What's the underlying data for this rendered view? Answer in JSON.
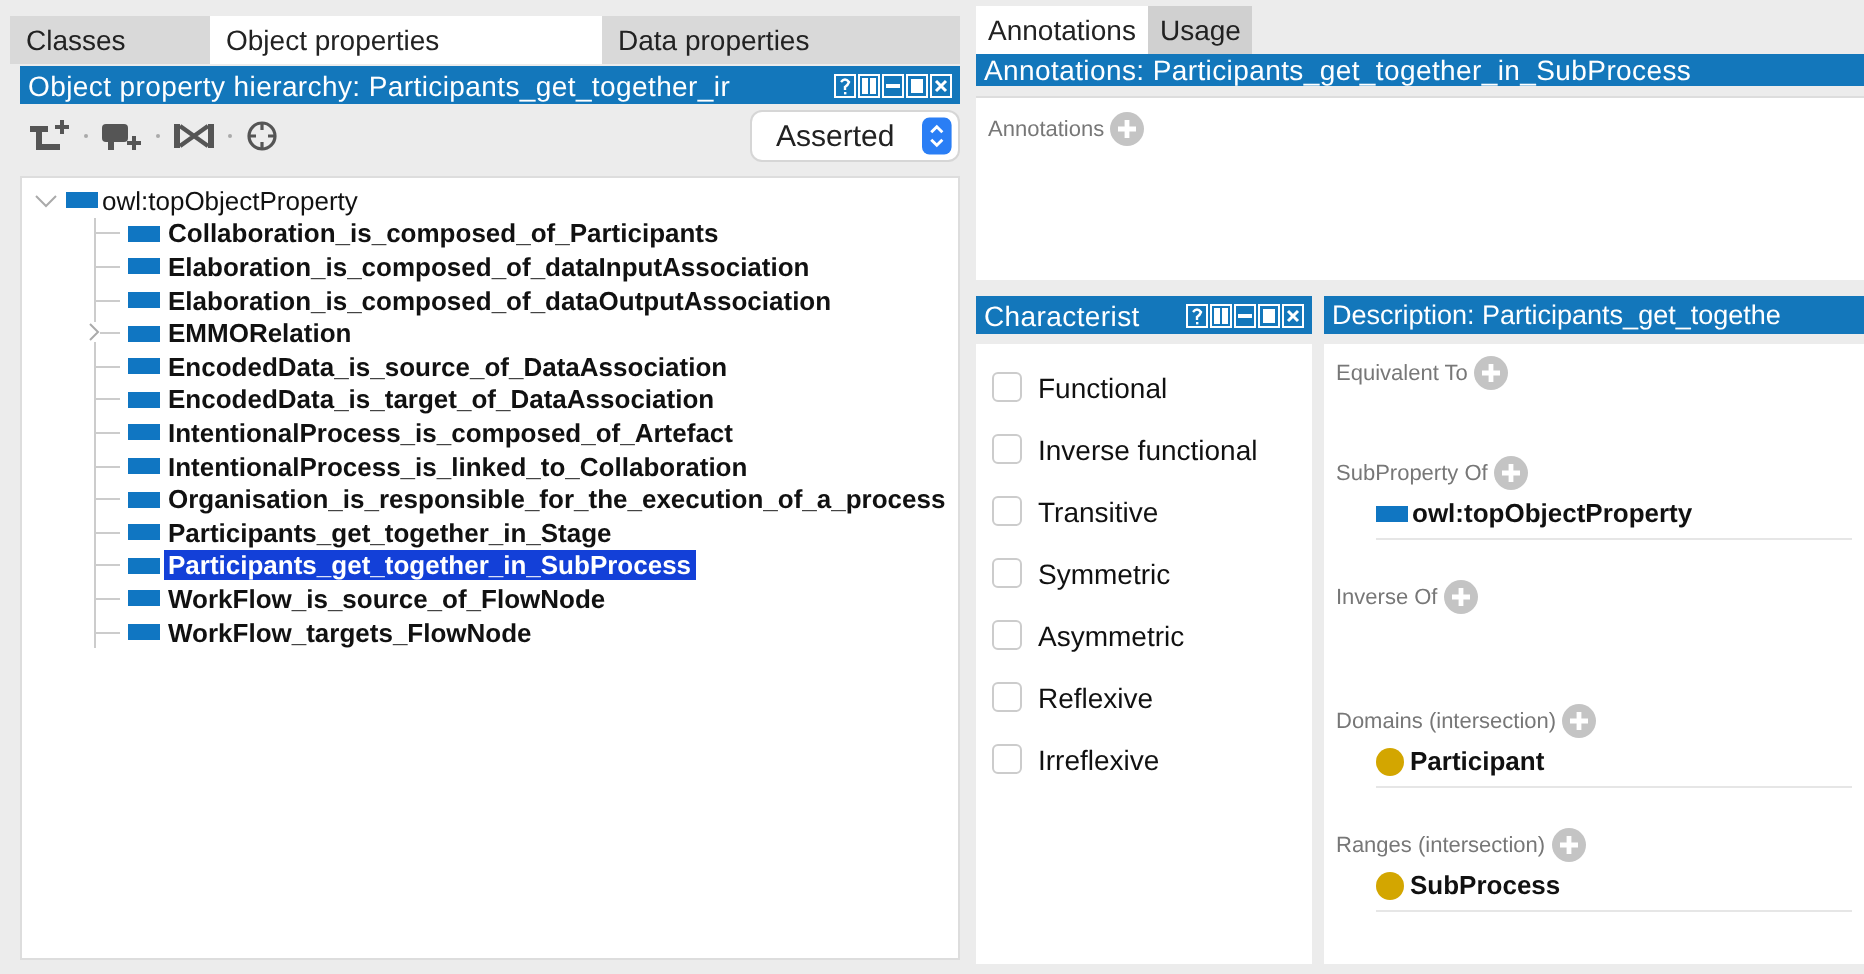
{
  "left_tabs": [
    {
      "label": "Classes",
      "selected": false
    },
    {
      "label": "Object properties",
      "selected": true
    },
    {
      "label": "Data properties",
      "selected": false
    }
  ],
  "hierarchy_panel": {
    "title": "Object property hierarchy: Participants_get_together_ir",
    "mode": "Asserted",
    "root": {
      "label": "owl:topObjectProperty",
      "expanded": true,
      "children": [
        {
          "label": "Collaboration_is_composed_of_Participants",
          "selected": false,
          "expandable": false
        },
        {
          "label": "Elaboration_is_composed_of_dataInputAssociation",
          "selected": false,
          "expandable": false
        },
        {
          "label": "Elaboration_is_composed_of_dataOutputAssociation",
          "selected": false,
          "expandable": false
        },
        {
          "label": "EMMORelation",
          "selected": false,
          "expandable": true
        },
        {
          "label": "EncodedData_is_source_of_DataAssociation",
          "selected": false,
          "expandable": false
        },
        {
          "label": "EncodedData_is_target_of_DataAssociation",
          "selected": false,
          "expandable": false
        },
        {
          "label": "IntentionalProcess_is_composed_of_Artefact",
          "selected": false,
          "expandable": false
        },
        {
          "label": "IntentionalProcess_is_linked_to_Collaboration",
          "selected": false,
          "expandable": false
        },
        {
          "label": "Organisation_is_responsible_for_the_execution_of_a_process",
          "selected": false,
          "expandable": false
        },
        {
          "label": "Participants_get_together_in_Stage",
          "selected": false,
          "expandable": false
        },
        {
          "label": "Participants_get_together_in_SubProcess",
          "selected": true,
          "expandable": false
        },
        {
          "label": "WorkFlow_is_source_of_FlowNode",
          "selected": false,
          "expandable": false
        },
        {
          "label": "WorkFlow_targets_FlowNode",
          "selected": false,
          "expandable": false
        }
      ]
    }
  },
  "right_tabs": [
    {
      "label": "Annotations",
      "selected": true
    },
    {
      "label": "Usage",
      "selected": false
    }
  ],
  "annotations_panel": {
    "title": "Annotations: Participants_get_together_in_SubProcess",
    "section_label": "Annotations"
  },
  "characteristics_panel": {
    "title": "Characterist",
    "items": [
      {
        "label": "Functional",
        "checked": false
      },
      {
        "label": "Inverse functional",
        "checked": false
      },
      {
        "label": "Transitive",
        "checked": false
      },
      {
        "label": "Symmetric",
        "checked": false
      },
      {
        "label": "Asymmetric",
        "checked": false
      },
      {
        "label": "Reflexive",
        "checked": false
      },
      {
        "label": "Irreflexive",
        "checked": false
      }
    ]
  },
  "description_panel": {
    "title": "Description: Participants_get_togethe",
    "sections": [
      {
        "label": "Equivalent To"
      },
      {
        "label": "SubProperty Of",
        "items": [
          {
            "label": "owl:topObjectProperty",
            "kind": "property"
          }
        ]
      },
      {
        "label": "Inverse Of"
      },
      {
        "label": "Domains (intersection)",
        "items": [
          {
            "label": "Participant",
            "kind": "class"
          }
        ]
      },
      {
        "label": "Ranges (intersection)",
        "items": [
          {
            "label": "SubProcess",
            "kind": "class"
          }
        ]
      }
    ]
  }
}
